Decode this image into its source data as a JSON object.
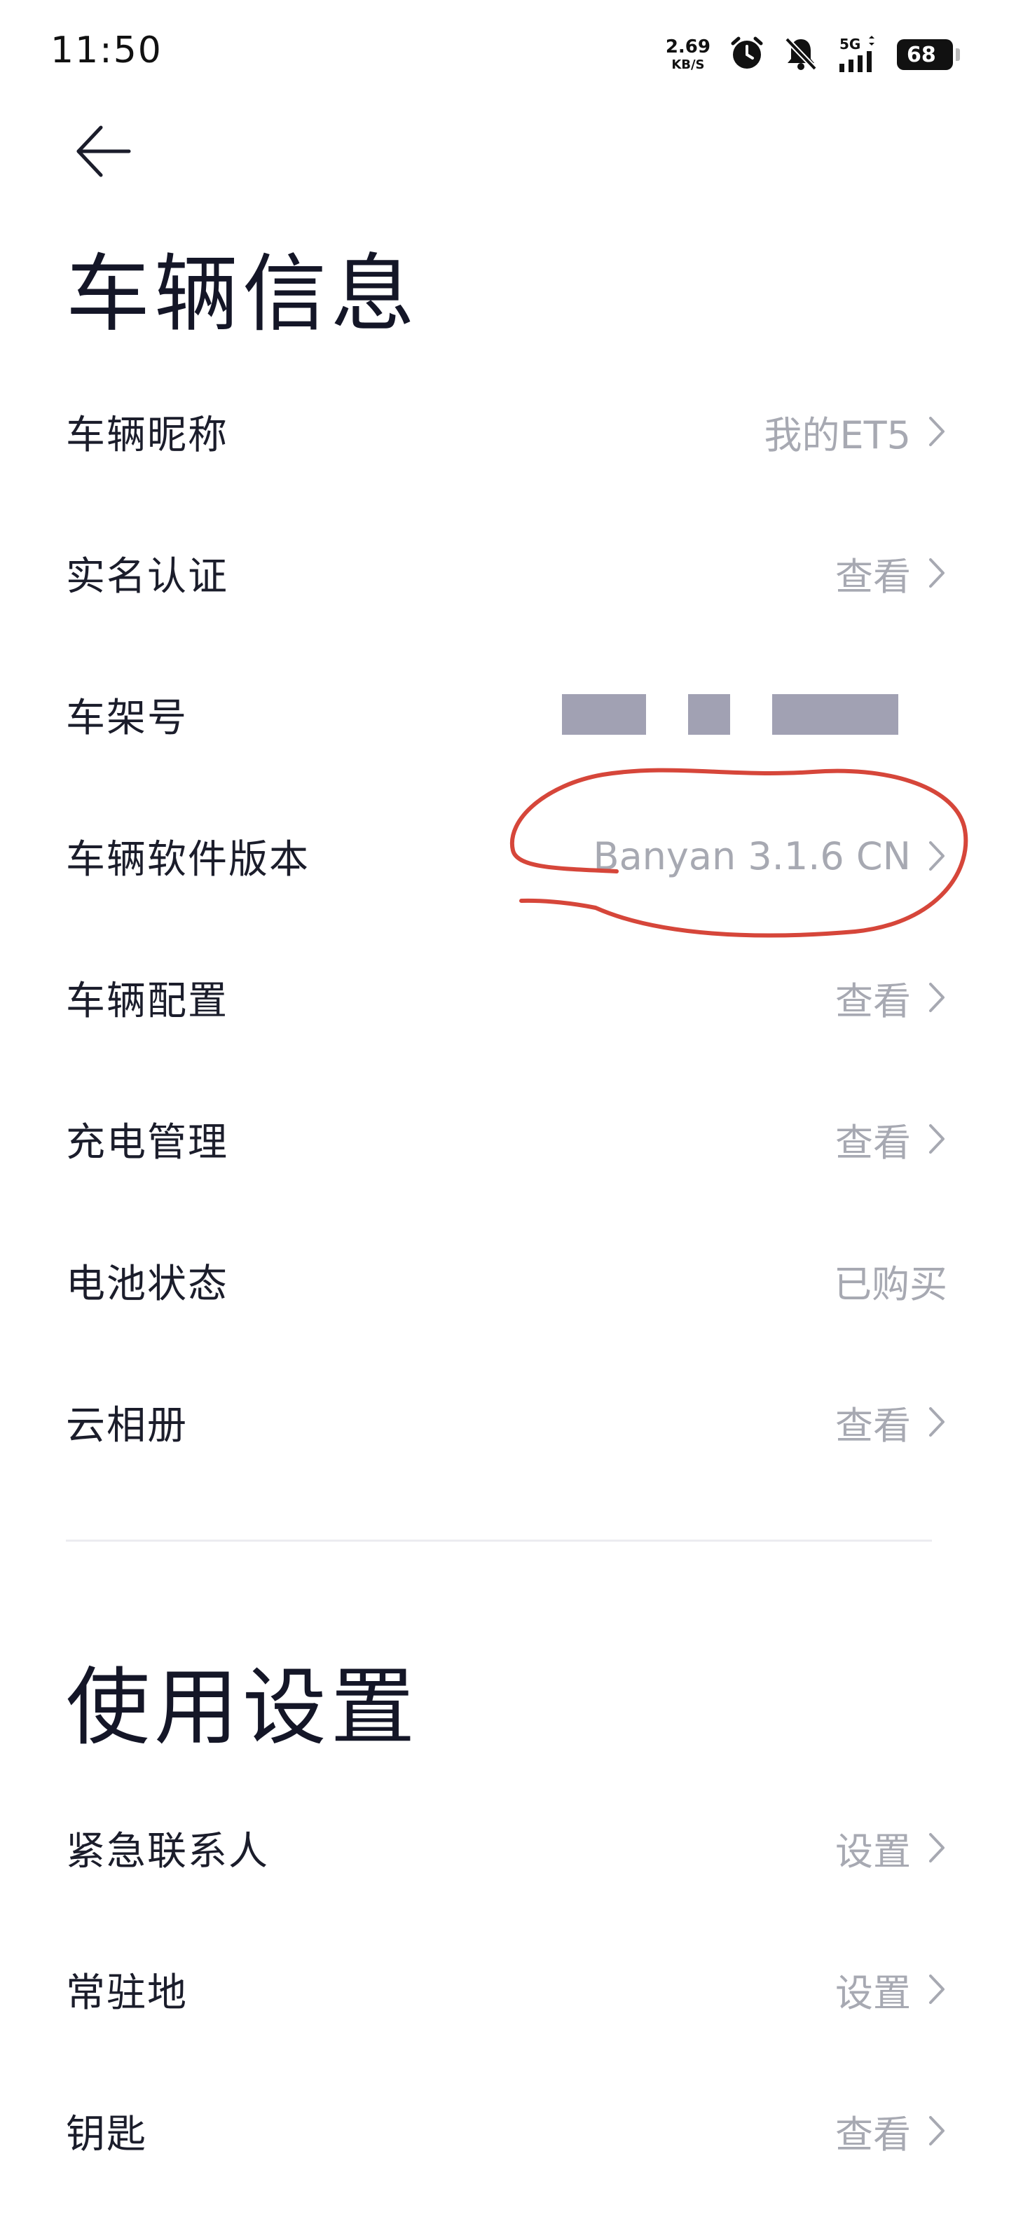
{
  "status_bar": {
    "time": "11:50",
    "net_speed_value": "2.69",
    "net_speed_unit": "KB/S",
    "network_type": "5G",
    "battery_level": "68",
    "icons": [
      "alarm-icon",
      "bell-muted-icon",
      "signal-icon",
      "battery-icon"
    ]
  },
  "nav": {
    "back_icon": "arrow-left-icon"
  },
  "vehicle_section": {
    "title": "车辆信息",
    "items": [
      {
        "label": "车辆昵称",
        "value": "我的ET5",
        "has_chevron": true
      },
      {
        "label": "实名认证",
        "value": "查看",
        "has_chevron": true
      },
      {
        "label": "车架号",
        "value": "",
        "redacted": true,
        "has_chevron": false
      },
      {
        "label": "车辆软件版本",
        "value": "Banyan 3.1.6 CN",
        "has_chevron": true,
        "annotated": true
      },
      {
        "label": "车辆配置",
        "value": "查看",
        "has_chevron": true
      },
      {
        "label": "充电管理",
        "value": "查看",
        "has_chevron": true
      },
      {
        "label": "电池状态",
        "value": "已购买",
        "has_chevron": false
      },
      {
        "label": "云相册",
        "value": "查看",
        "has_chevron": true
      }
    ]
  },
  "usage_section": {
    "title": "使用设置",
    "items": [
      {
        "label": "紧急联系人",
        "value": "设置",
        "has_chevron": true
      },
      {
        "label": "常驻地",
        "value": "设置",
        "has_chevron": true
      },
      {
        "label": "钥匙",
        "value": "查看",
        "has_chevron": true
      }
    ]
  },
  "colors": {
    "text_primary": "#1b1d2b",
    "text_secondary": "#a7a9b2",
    "annotation_red": "#d6463a",
    "redaction": "#a1a1b3"
  }
}
